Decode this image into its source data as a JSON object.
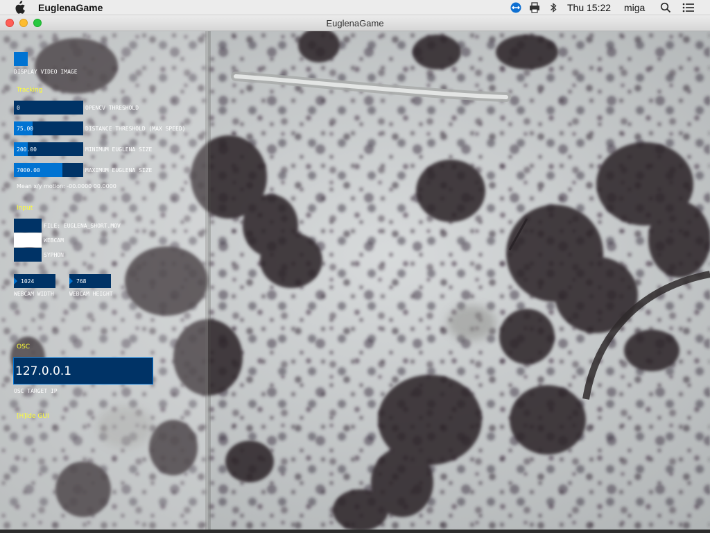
{
  "menubar": {
    "app_name": "EuglenaGame",
    "clock": "Thu 15:22",
    "user": "miga",
    "icons": [
      "apple-icon",
      "teamviewer-icon",
      "printer-icon",
      "bluetooth-icon",
      "spotlight-search-icon",
      "notification-center-icon"
    ]
  },
  "window": {
    "title": "EuglenaGame"
  },
  "gui": {
    "display_video_label": "DISPLAY VIDEO IMAGE",
    "tracking_header": "Tracking",
    "sliders": [
      {
        "value": "0",
        "label": "OPENCV THRESHOLD",
        "fill": 0.0
      },
      {
        "value": "75.00",
        "label": "DISTANCE THRESHOLD (MAX SPEED)",
        "fill": 0.27
      },
      {
        "value": "200.00",
        "label": "MINIMUM EUGLENA SIZE",
        "fill": 0.2
      },
      {
        "value": "7000.00",
        "label": "MAXIMUM EUGLENA SIZE",
        "fill": 0.7
      }
    ],
    "motion_text": "Mean x/y motion: -00.0000 00.0000",
    "input_header": "Input",
    "inputs": [
      {
        "label": "FILE: EUGLENA_SHORT.MOV",
        "active": false
      },
      {
        "label": "WEBCAM",
        "active": true
      },
      {
        "label": "SYPHON",
        "active": false
      }
    ],
    "webcam_width": {
      "value": "1024",
      "label": "WEBCAM WIDTH"
    },
    "webcam_height": {
      "value": "768",
      "label": "WEBCAM HEIGHT"
    },
    "osc_header": "OSC",
    "osc_ip": "127.0.0.1",
    "osc_label": "OSC TARGET IP",
    "hide_gui": "[H]ide GUI"
  },
  "colors": {
    "control_bg": "#003366",
    "control_active": "#0073d2",
    "header_text": "#ffff33",
    "close": "#ff5f57",
    "minimize": "#febc2e",
    "zoom": "#28c840"
  }
}
